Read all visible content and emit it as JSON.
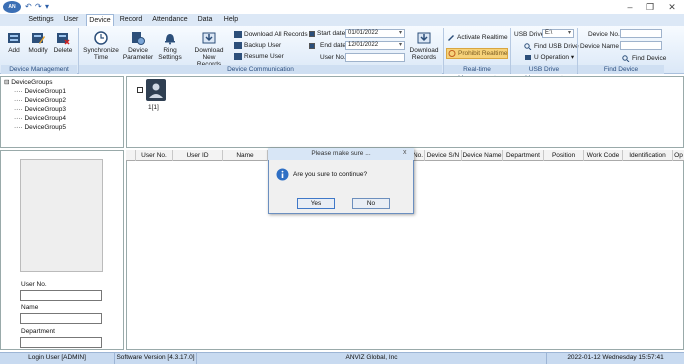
{
  "quick_access": {
    "undo": "↶",
    "redo": "↷",
    "customize": "▾"
  },
  "window": {
    "minimize": "–",
    "restore": "❐",
    "close": "✕"
  },
  "tabs": [
    "Settings",
    "User",
    "Device",
    "Record",
    "Attendance",
    "Data",
    "Help"
  ],
  "ribbon": {
    "device_management": {
      "label": "Device Management",
      "add": "Add",
      "modify": "Modify",
      "delete": "Delete"
    },
    "device_communication": {
      "label": "Device Communication",
      "sync_time": [
        "Synchronize",
        "Time"
      ],
      "device_param": [
        "Device",
        "Parameter"
      ],
      "ring_settings": [
        "Ring",
        "Settings"
      ],
      "download_new": [
        "Download",
        "New Records"
      ],
      "download_all": "Download All Records",
      "backup_user": "Backup User",
      "resume_user": "Resume User",
      "start_date_label": "Start date",
      "start_date": "01/01/2022",
      "end_date_label": "End date",
      "end_date": "12/01/2022",
      "user_no_label": "User No.",
      "download_records": [
        "Download",
        "Records"
      ]
    },
    "realtime": {
      "label": "Real-time Management",
      "activate": "Activate Realtime",
      "prohibit": "Prohibit Realtime"
    },
    "usb": {
      "label": "USB Drive Management",
      "drive_label": "USB Drive",
      "drive_value": "E:\\",
      "find": "Find USB Drive",
      "operation": "U Operation"
    },
    "find_device": {
      "label": "Find Device",
      "device_no": "Device No.",
      "device_name": "Device Name",
      "find": "Find Device"
    }
  },
  "tree": {
    "root": "DeviceGroups",
    "items": [
      "DeviceGroup1",
      "DeviceGroup2",
      "DeviceGroup3",
      "DeviceGroup4",
      "DeviceGroup5"
    ]
  },
  "device_tile": {
    "label": "1[1]"
  },
  "left": {
    "user_no": "User No.",
    "name": "Name",
    "department": "Department"
  },
  "grid_columns": [
    "User No.",
    "User ID",
    "Name",
    "No.",
    "Device S/N",
    "Device Name",
    "Department",
    "Position",
    "Work Code",
    "Identification",
    "Op"
  ],
  "dialog": {
    "title": "Please make sure ...",
    "close": "x",
    "message": "Are you sure to continue?",
    "yes": "Yes",
    "no": "No"
  },
  "status": {
    "login": "Login User [ADMIN]",
    "version": "Software Version [4.3.17.0]",
    "company": "ANVIZ Global, Inc",
    "datetime": "2022-01-12 Wednesday 15:57:41"
  },
  "colors": {
    "accent": "#2b5ea8",
    "ribbon_group": "#cfdff2",
    "status": "#c8daf0"
  }
}
